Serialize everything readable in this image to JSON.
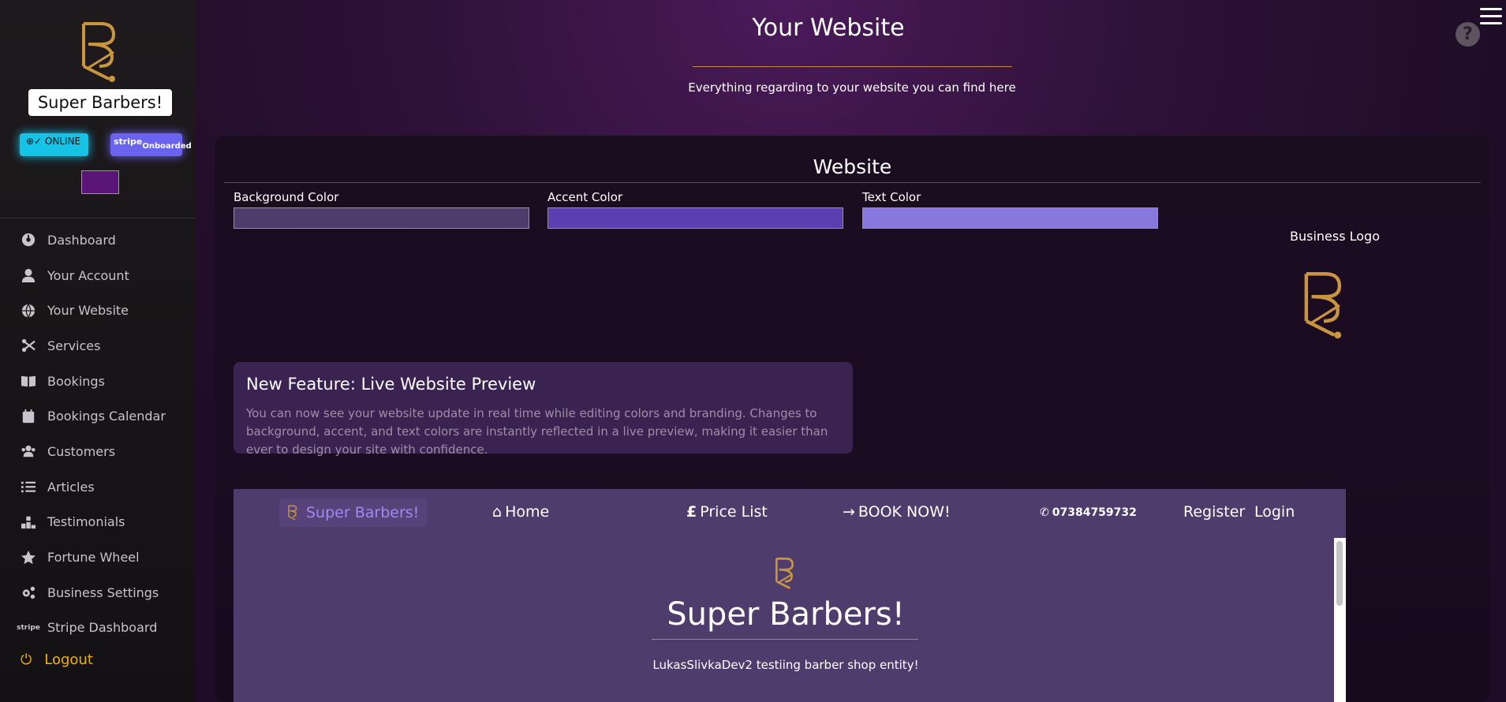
{
  "sidebar": {
    "brand_name": "Super Barbers!",
    "online_badge": "⊕✓ ONLINE",
    "stripe_badge_main": "stripe",
    "stripe_badge_sub": "Onboarded",
    "items": [
      {
        "label": "Dashboard",
        "icon": "dashboard-icon"
      },
      {
        "label": "Your Account",
        "icon": "user-icon"
      },
      {
        "label": "Your Website",
        "icon": "globe-icon"
      },
      {
        "label": "Services",
        "icon": "scissors-icon"
      },
      {
        "label": "Bookings",
        "icon": "book-icon"
      },
      {
        "label": "Bookings Calendar",
        "icon": "calendar-icon"
      },
      {
        "label": "Customers",
        "icon": "users-icon"
      },
      {
        "label": "Articles",
        "icon": "list-icon"
      },
      {
        "label": "Testimonials",
        "icon": "podium-icon"
      },
      {
        "label": "Fortune Wheel",
        "icon": "star-icon"
      },
      {
        "label": "Business Settings",
        "icon": "cogs-icon"
      },
      {
        "label": "Stripe Dashboard",
        "icon": "stripe-icon"
      }
    ],
    "logout": "Logout"
  },
  "header": {
    "title": "Your Website",
    "subtitle": "Everything regarding to your website you can find here"
  },
  "panel": {
    "title": "Website",
    "background_color_label": "Background Color",
    "accent_color_label": "Accent Color",
    "text_color_label": "Text Color",
    "business_logo_label": "Business Logo"
  },
  "colors": {
    "background": "#4e3c6d",
    "accent": "#5a3fb0",
    "text": "#8877dd",
    "brand_gold": "#c9963f",
    "sidebar_swatch": "#5a1577"
  },
  "feature": {
    "title": "New Feature: Live Website Preview",
    "text": "You can now see your website update in real time while editing colors and branding. Changes to background, accent, and text colors are instantly reflected in a live preview, making it easier than ever to design your site with confidence."
  },
  "preview": {
    "brand": "Super Barbers!",
    "home": "Home",
    "price_list": "Price List",
    "book_now": "BOOK NOW!",
    "phone": "07384759732",
    "register": "Register",
    "login": "Login",
    "hero_title": "Super Barbers!",
    "hero_subtitle": "LukasSlivkaDev2 testiing barber shop entity!"
  }
}
